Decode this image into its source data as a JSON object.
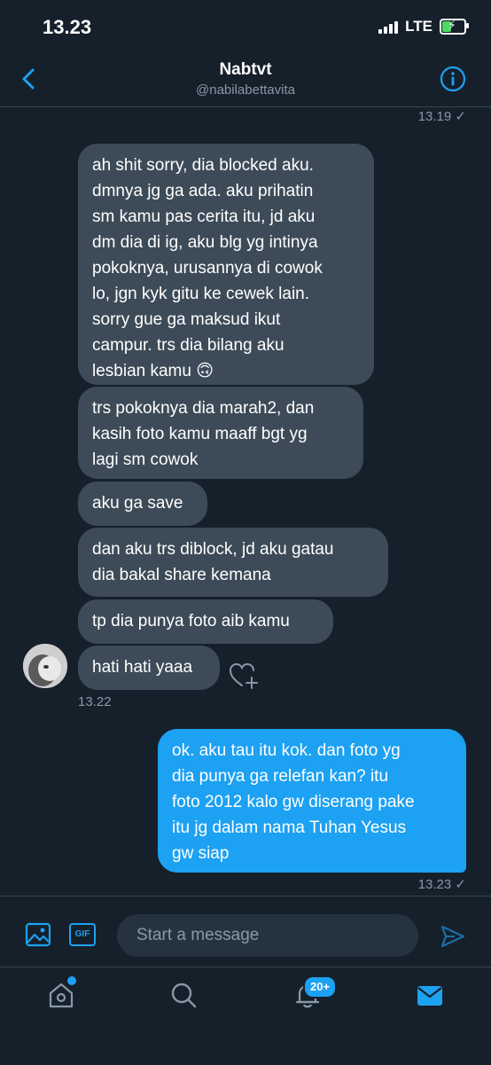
{
  "status_bar": {
    "time": "13.23",
    "network": "LTE"
  },
  "header": {
    "name": "Nabtvt",
    "handle": "@nabilabettavita"
  },
  "messages": {
    "top_timestamp": "13.19",
    "received": [
      "ah shit sorry, dia blocked aku.\ndmnya jg ga ada. aku prihatin\nsm kamu pas cerita itu, jd aku\ndm dia di ig, aku blg yg intinya\npokoknya, urusannya di cowok\nlo, jgn kyk gitu ke cewek lain.\nsorry gue ga maksud ikut\ncampur. trs dia bilang aku\nlesbian kamu 🙃",
      "trs pokoknya dia marah2, dan\nkasih foto kamu maaff bgt yg\nlagi sm cowok",
      "aku ga save",
      "dan aku trs diblock, jd aku gatau\ndia bakal share kemana",
      "tp dia punya foto aib kamu",
      "hati hati yaaa"
    ],
    "received_time": "13.22",
    "sent": "ok. aku tau itu kok. dan foto yg\ndia punya ga relefan kan? itu\nfoto 2012 kalo gw diserang pake\nitu jg dalam nama Tuhan Yesus\ngw siap",
    "sent_time": "13.23"
  },
  "composer": {
    "placeholder": "Start a message",
    "gif_label": "GIF"
  },
  "tabbar": {
    "notifications_badge": "20+"
  },
  "colors": {
    "background": "#15202b",
    "accent": "#1da1f2",
    "bubble_in": "#3d4b58"
  }
}
